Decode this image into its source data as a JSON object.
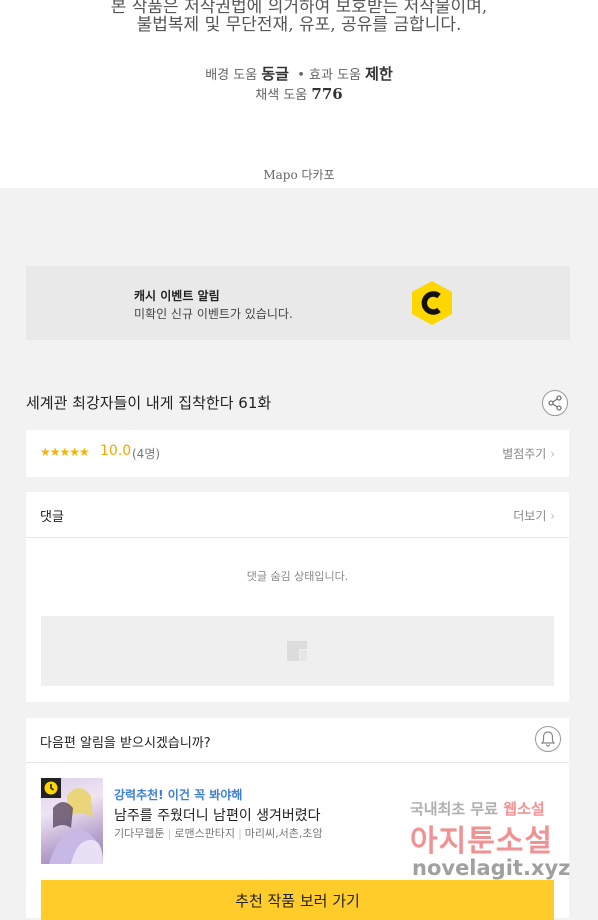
{
  "credits": {
    "line1": "본 작품은 저작권법에 의거하여 보호받는 저작물이며,",
    "line2": "불법복제 및 무단전재, 유포, 공유를 금합니다.",
    "bg_help_label": "배경 도움",
    "bg_help_name": "동글",
    "sep": "•",
    "fx_help_label": "효과 도움",
    "fx_help_name": "제한",
    "color_help_label": "채색 도움",
    "color_help_name": "776",
    "publisher": "Mapo 다카포"
  },
  "banner": {
    "title": "캐시 이벤트 알림",
    "subtitle": "미확인 신규 이벤트가 있습니다.",
    "logo_icon": "cash-c-logo-icon",
    "logo_color": "#ffd600"
  },
  "episode": {
    "title": "세계관 최강자들이 내게 집착한다 61화",
    "share_icon": "share-icon"
  },
  "rating": {
    "stars": "★★★★★",
    "score": "10.0",
    "count": "(4명)",
    "rate_link": "별점주기"
  },
  "comments": {
    "header": "댓글",
    "more_link": "더보기",
    "status": "댓글 숨김 상태입니다.",
    "placeholder_icon": "image-placeholder-icon"
  },
  "notify": {
    "question": "다음편 알림을 받으시겠습니까?",
    "bell_icon": "bell-icon",
    "recommendation_label": "강력추천! 이건 꼭 봐야해",
    "recommended_title": "남주를 주웠더니 남편이 생겨버렸다",
    "tags": [
      "기다무웹툰",
      "로맨스판타지",
      "마리씨,서촌,초암"
    ],
    "button_label": "추천 작품 보러 가기",
    "accent_color": "#ffcc2a",
    "label_color": "#3d7fd6"
  },
  "watermark": {
    "line1_a": "국내최초 무료",
    "line1_b": "웹소설",
    "line2": "아지툰소설",
    "line3": "novelagit.xyz"
  }
}
